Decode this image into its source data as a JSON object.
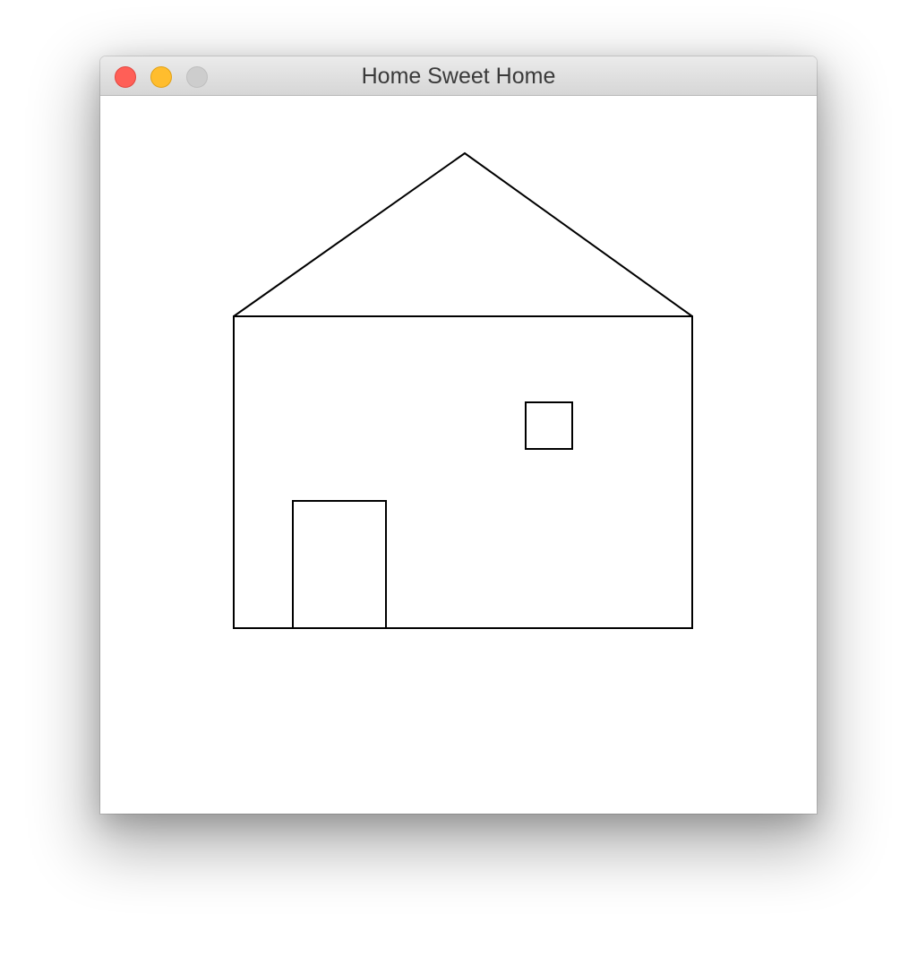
{
  "window": {
    "title": "Home Sweet Home",
    "controls": {
      "close": {
        "icon": "close-icon",
        "color": "#ff5f57"
      },
      "minimize": {
        "icon": "minimize-icon",
        "color": "#ffbd2e"
      },
      "zoom": {
        "icon": "zoom-icon",
        "color": "#cdcdcd"
      }
    }
  },
  "drawing": {
    "stroke_color": "#000000",
    "background": "#ffffff"
  }
}
